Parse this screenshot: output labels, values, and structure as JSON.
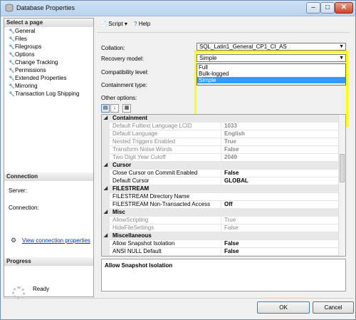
{
  "window": {
    "title": "Database Properties"
  },
  "sidebar": {
    "select_header": "Select a page",
    "pages": [
      "General",
      "Files",
      "Filegroups",
      "Options",
      "Change Tracking",
      "Permissions",
      "Extended Properties",
      "Mirroring",
      "Transaction Log Shipping"
    ],
    "connection_header": "Connection",
    "server_label": "Server:",
    "connection_label": "Connection:",
    "view_link": "View connection properties",
    "progress_header": "Progress",
    "status": "Ready"
  },
  "toolbar": {
    "script_label": "Script",
    "help_label": "Help"
  },
  "form": {
    "collation_label": "Collation:",
    "collation_value": "SQL_Latin1_General_CP1_CI_AS",
    "recovery_label": "Recovery model:",
    "recovery_value": "Simple",
    "recovery_options": [
      "Full",
      "Bulk-logged",
      "Simple"
    ],
    "compat_label": "Compatibility level:",
    "containment_label": "Containment type:",
    "other_label": "Other options:"
  },
  "grid": {
    "rows": [
      {
        "type": "cat",
        "name": "Containment"
      },
      {
        "type": "prop",
        "name": "Default Fulltext Language LCID",
        "value": "1033",
        "ro": true,
        "bold": true
      },
      {
        "type": "prop",
        "name": "Default Language",
        "value": "English",
        "ro": true,
        "bold": true
      },
      {
        "type": "prop",
        "name": "Nested Triggers Enabled",
        "value": "True",
        "ro": true,
        "bold": true
      },
      {
        "type": "prop",
        "name": "Transform Noise Words",
        "value": "False",
        "ro": true,
        "bold": true
      },
      {
        "type": "prop",
        "name": "Two Digit Year Cutoff",
        "value": "2049",
        "ro": true,
        "bold": true
      },
      {
        "type": "cat",
        "name": "Cursor"
      },
      {
        "type": "prop",
        "name": "Close Cursor on Commit Enabled",
        "value": "False",
        "ro": false,
        "bold": true
      },
      {
        "type": "prop",
        "name": "Default Cursor",
        "value": "GLOBAL",
        "ro": false,
        "bold": true
      },
      {
        "type": "cat",
        "name": "FILESTREAM"
      },
      {
        "type": "prop",
        "name": "FILESTREAM Directory Name",
        "value": "",
        "ro": false,
        "bold": false
      },
      {
        "type": "prop",
        "name": "FILESTREAM Non-Transacted Access",
        "value": "Off",
        "ro": false,
        "bold": true
      },
      {
        "type": "cat",
        "name": "Misc"
      },
      {
        "type": "prop",
        "name": "AllowScripting",
        "value": "True",
        "ro": true,
        "bold": false
      },
      {
        "type": "prop",
        "name": "HideFileSettings",
        "value": "False",
        "ro": true,
        "bold": false
      },
      {
        "type": "cat",
        "name": "Miscellaneous"
      },
      {
        "type": "prop",
        "name": "Allow Snapshot Isolation",
        "value": "False",
        "ro": false,
        "bold": true
      },
      {
        "type": "prop",
        "name": "ANSI NULL Default",
        "value": "False",
        "ro": false,
        "bold": true
      }
    ]
  },
  "description": "Allow Snapshot Isolation",
  "buttons": {
    "ok": "OK",
    "cancel": "Cancel"
  }
}
